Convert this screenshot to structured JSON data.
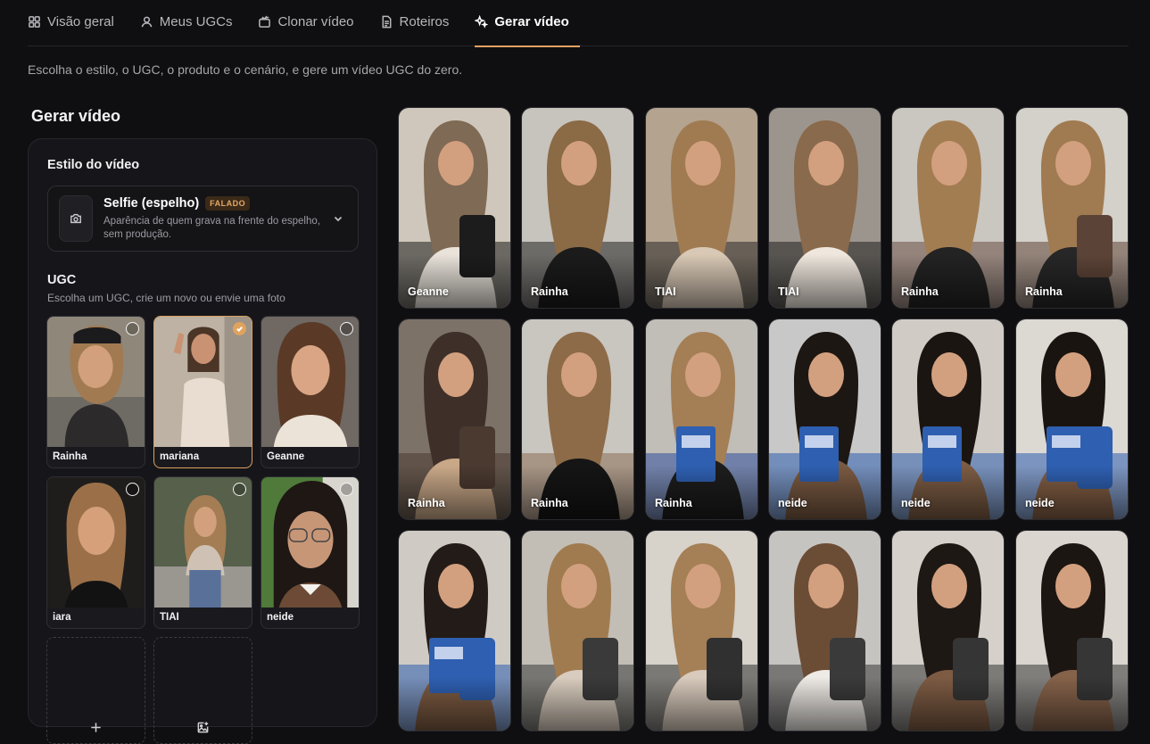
{
  "tabs": [
    {
      "label": "Visão geral",
      "icon": "grid-icon"
    },
    {
      "label": "Meus UGCs",
      "icon": "user-icon"
    },
    {
      "label": "Clonar vídeo",
      "icon": "clapper-icon"
    },
    {
      "label": "Roteiros",
      "icon": "document-icon"
    },
    {
      "label": "Gerar vídeo",
      "icon": "sparkles-icon",
      "active": true
    }
  ],
  "subtitle": "Escolha o estilo, o UGC, o produto e o cenário, e gere um vídeo UGC do zero.",
  "page_title": "Gerar vídeo",
  "style_section": {
    "title": "Estilo do vídeo",
    "name": "Selfie (espelho)",
    "badge": "FALADO",
    "description": "Aparência de quem grava na frente do espelho, sem produção."
  },
  "ugc_section": {
    "title": "UGC",
    "subtitle": "Escolha um UGC, crie um novo ou envie uma foto",
    "items": [
      {
        "name": "Rainha",
        "selected": false
      },
      {
        "name": "mariana",
        "selected": true
      },
      {
        "name": "Geanne",
        "selected": false
      },
      {
        "name": "iara",
        "selected": false
      },
      {
        "name": "TIAI",
        "selected": false
      },
      {
        "name": "neide",
        "selected": false
      }
    ]
  },
  "gallery": [
    {
      "name": "Geanne"
    },
    {
      "name": "Rainha"
    },
    {
      "name": "TIAI"
    },
    {
      "name": "TIAI"
    },
    {
      "name": "Rainha"
    },
    {
      "name": "Rainha"
    },
    {
      "name": "Rainha"
    },
    {
      "name": "Rainha"
    },
    {
      "name": "Rainha"
    },
    {
      "name": "neide"
    },
    {
      "name": "neide"
    },
    {
      "name": "neide"
    },
    {
      "name": ""
    },
    {
      "name": ""
    },
    {
      "name": ""
    },
    {
      "name": ""
    },
    {
      "name": ""
    },
    {
      "name": ""
    }
  ],
  "colors": {
    "accent": "#e7a165",
    "background": "#0f0f11",
    "panel": "#16161a"
  }
}
